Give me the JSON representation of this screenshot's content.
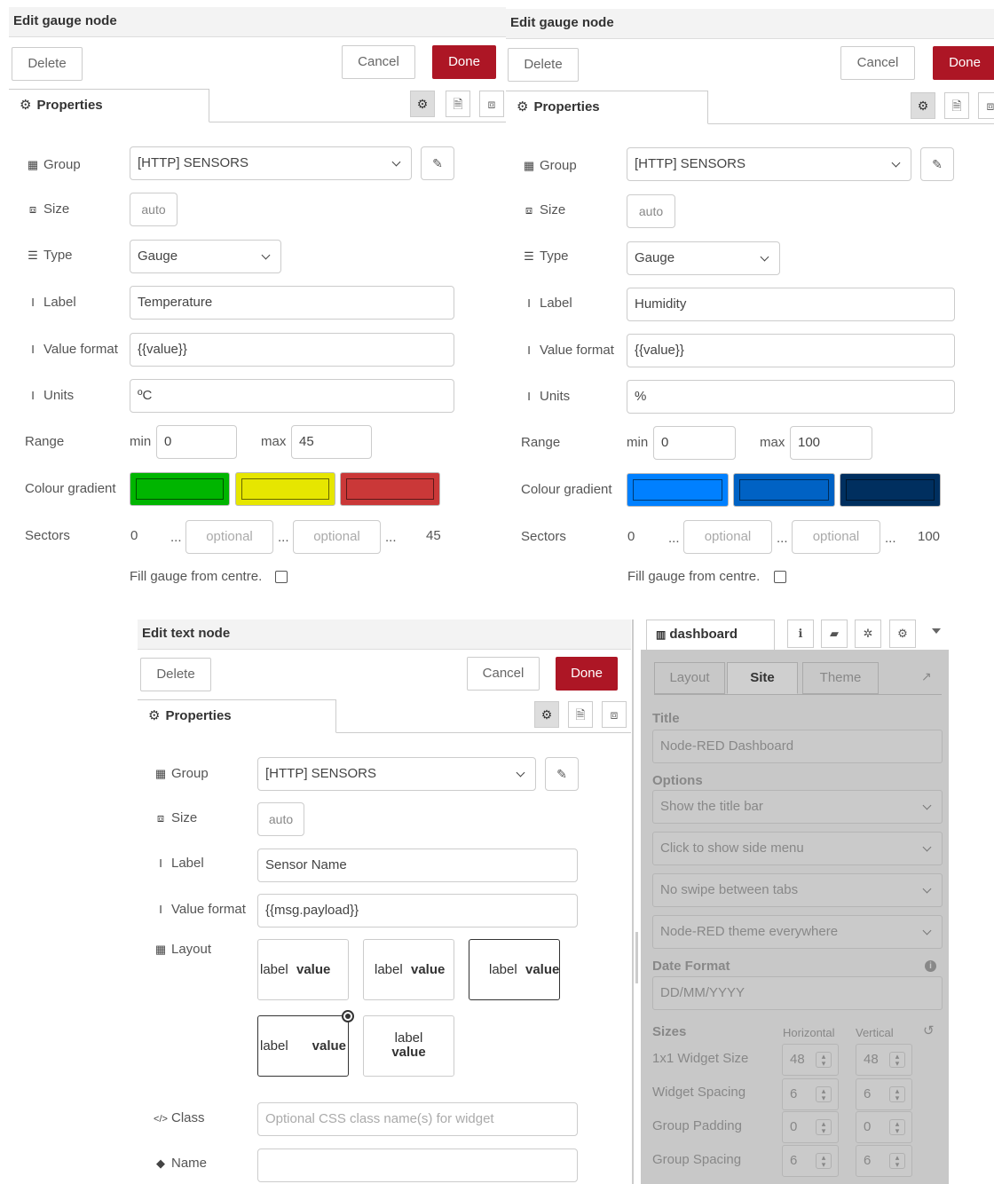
{
  "gauge1": {
    "title": "Edit gauge node",
    "delete": "Delete",
    "cancel": "Cancel",
    "done": "Done",
    "tab": "Properties",
    "labels": {
      "group": "Group",
      "size": "Size",
      "type": "Type",
      "label": "Label",
      "value_format": "Value format",
      "units": "Units",
      "range": "Range",
      "colour": "Colour gradient",
      "sectors": "Sectors"
    },
    "group_value": "[HTTP] SENSORS",
    "size_value": "auto",
    "type_value": "Gauge",
    "label_value": "Temperature",
    "format_value": "{{value}}",
    "units_value": "ºC",
    "min_label": "min",
    "min_value": "0",
    "max_label": "max",
    "max_value": "45",
    "colors": [
      "#00b500",
      "#e6e600",
      "#ca3838"
    ],
    "sector_start": "0",
    "sector_end": "45",
    "ellipsis": "...",
    "optional": "optional",
    "fill_label": "Fill gauge from centre."
  },
  "gauge2": {
    "title": "Edit gauge node",
    "delete": "Delete",
    "cancel": "Cancel",
    "done": "Done",
    "tab": "Properties",
    "labels": {
      "group": "Group",
      "size": "Size",
      "type": "Type",
      "label": "Label",
      "value_format": "Value format",
      "units": "Units",
      "range": "Range",
      "colour": "Colour gradient",
      "sectors": "Sectors"
    },
    "group_value": "[HTTP] SENSORS",
    "size_value": "auto",
    "type_value": "Gauge",
    "label_value": "Humidity",
    "format_value": "{{value}}",
    "units_value": "%",
    "min_label": "min",
    "min_value": "0",
    "max_label": "max",
    "max_value": "100",
    "colors": [
      "#0080ff",
      "#0062c4",
      "#002f5f"
    ],
    "sector_start": "0",
    "sector_end": "100",
    "ellipsis": "...",
    "optional": "optional",
    "fill_label": "Fill gauge from centre."
  },
  "text_node": {
    "title": "Edit text node",
    "delete": "Delete",
    "cancel": "Cancel",
    "done": "Done",
    "tab": "Properties",
    "labels": {
      "group": "Group",
      "size": "Size",
      "label": "Label",
      "value_format": "Value format",
      "layout": "Layout",
      "class": "Class",
      "name": "Name"
    },
    "group_value": "[HTTP] SENSORS",
    "size_value": "auto",
    "label_value": "Sensor Name",
    "format_value": "{{msg.payload}}",
    "layout_label": "label",
    "layout_value": "value",
    "class_placeholder": "Optional CSS class name(s) for widget",
    "name_value": ""
  },
  "dashboard": {
    "tab": "dashboard",
    "subtabs": [
      "Layout",
      "Site",
      "Theme"
    ],
    "title_heading": "Title",
    "title_value": "Node-RED Dashboard",
    "options_heading": "Options",
    "options": [
      "Show the title bar",
      "Click to show side menu",
      "No swipe between tabs",
      "Node-RED theme everywhere"
    ],
    "date_heading": "Date Format",
    "date_value": "DD/MM/YYYY",
    "sizes_heading": "Sizes",
    "horizontal": "Horizontal",
    "vertical": "Vertical",
    "size_rows": [
      {
        "label": "1x1 Widget Size",
        "h": "48",
        "v": "48"
      },
      {
        "label": "Widget Spacing",
        "h": "6",
        "v": "6"
      },
      {
        "label": "Group Padding",
        "h": "0",
        "v": "0"
      },
      {
        "label": "Group Spacing",
        "h": "6",
        "v": "6"
      }
    ]
  }
}
